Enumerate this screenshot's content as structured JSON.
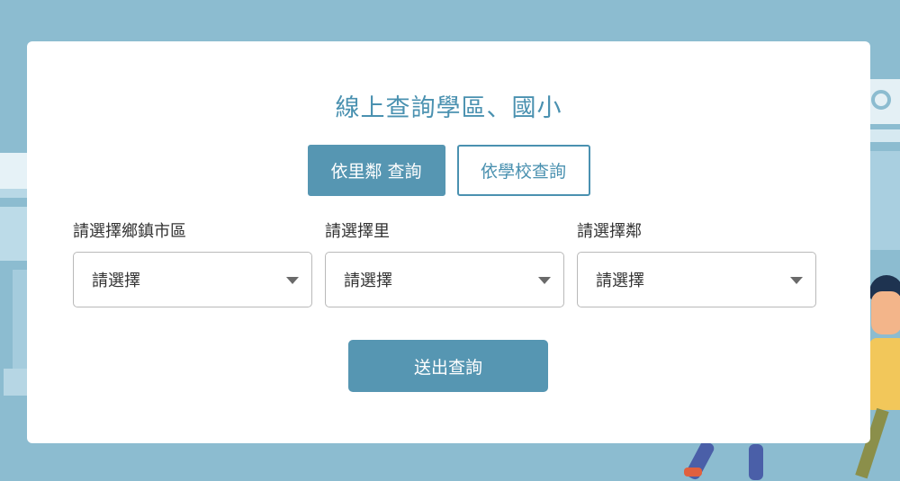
{
  "page": {
    "title": "線上查詢學區、國小"
  },
  "tabs": [
    {
      "label": "依里鄰 查詢",
      "active": true
    },
    {
      "label": "依學校查詢",
      "active": false
    }
  ],
  "fields": [
    {
      "label": "請選擇鄉鎮市區",
      "value": "請選擇"
    },
    {
      "label": "請選擇里",
      "value": "請選擇"
    },
    {
      "label": "請選擇鄰",
      "value": "請選擇"
    }
  ],
  "submit": {
    "label": "送出查詢"
  },
  "colors": {
    "background": "#8cbcd0",
    "accent": "#5696b2",
    "title": "#4a91b0",
    "card": "#ffffff"
  }
}
